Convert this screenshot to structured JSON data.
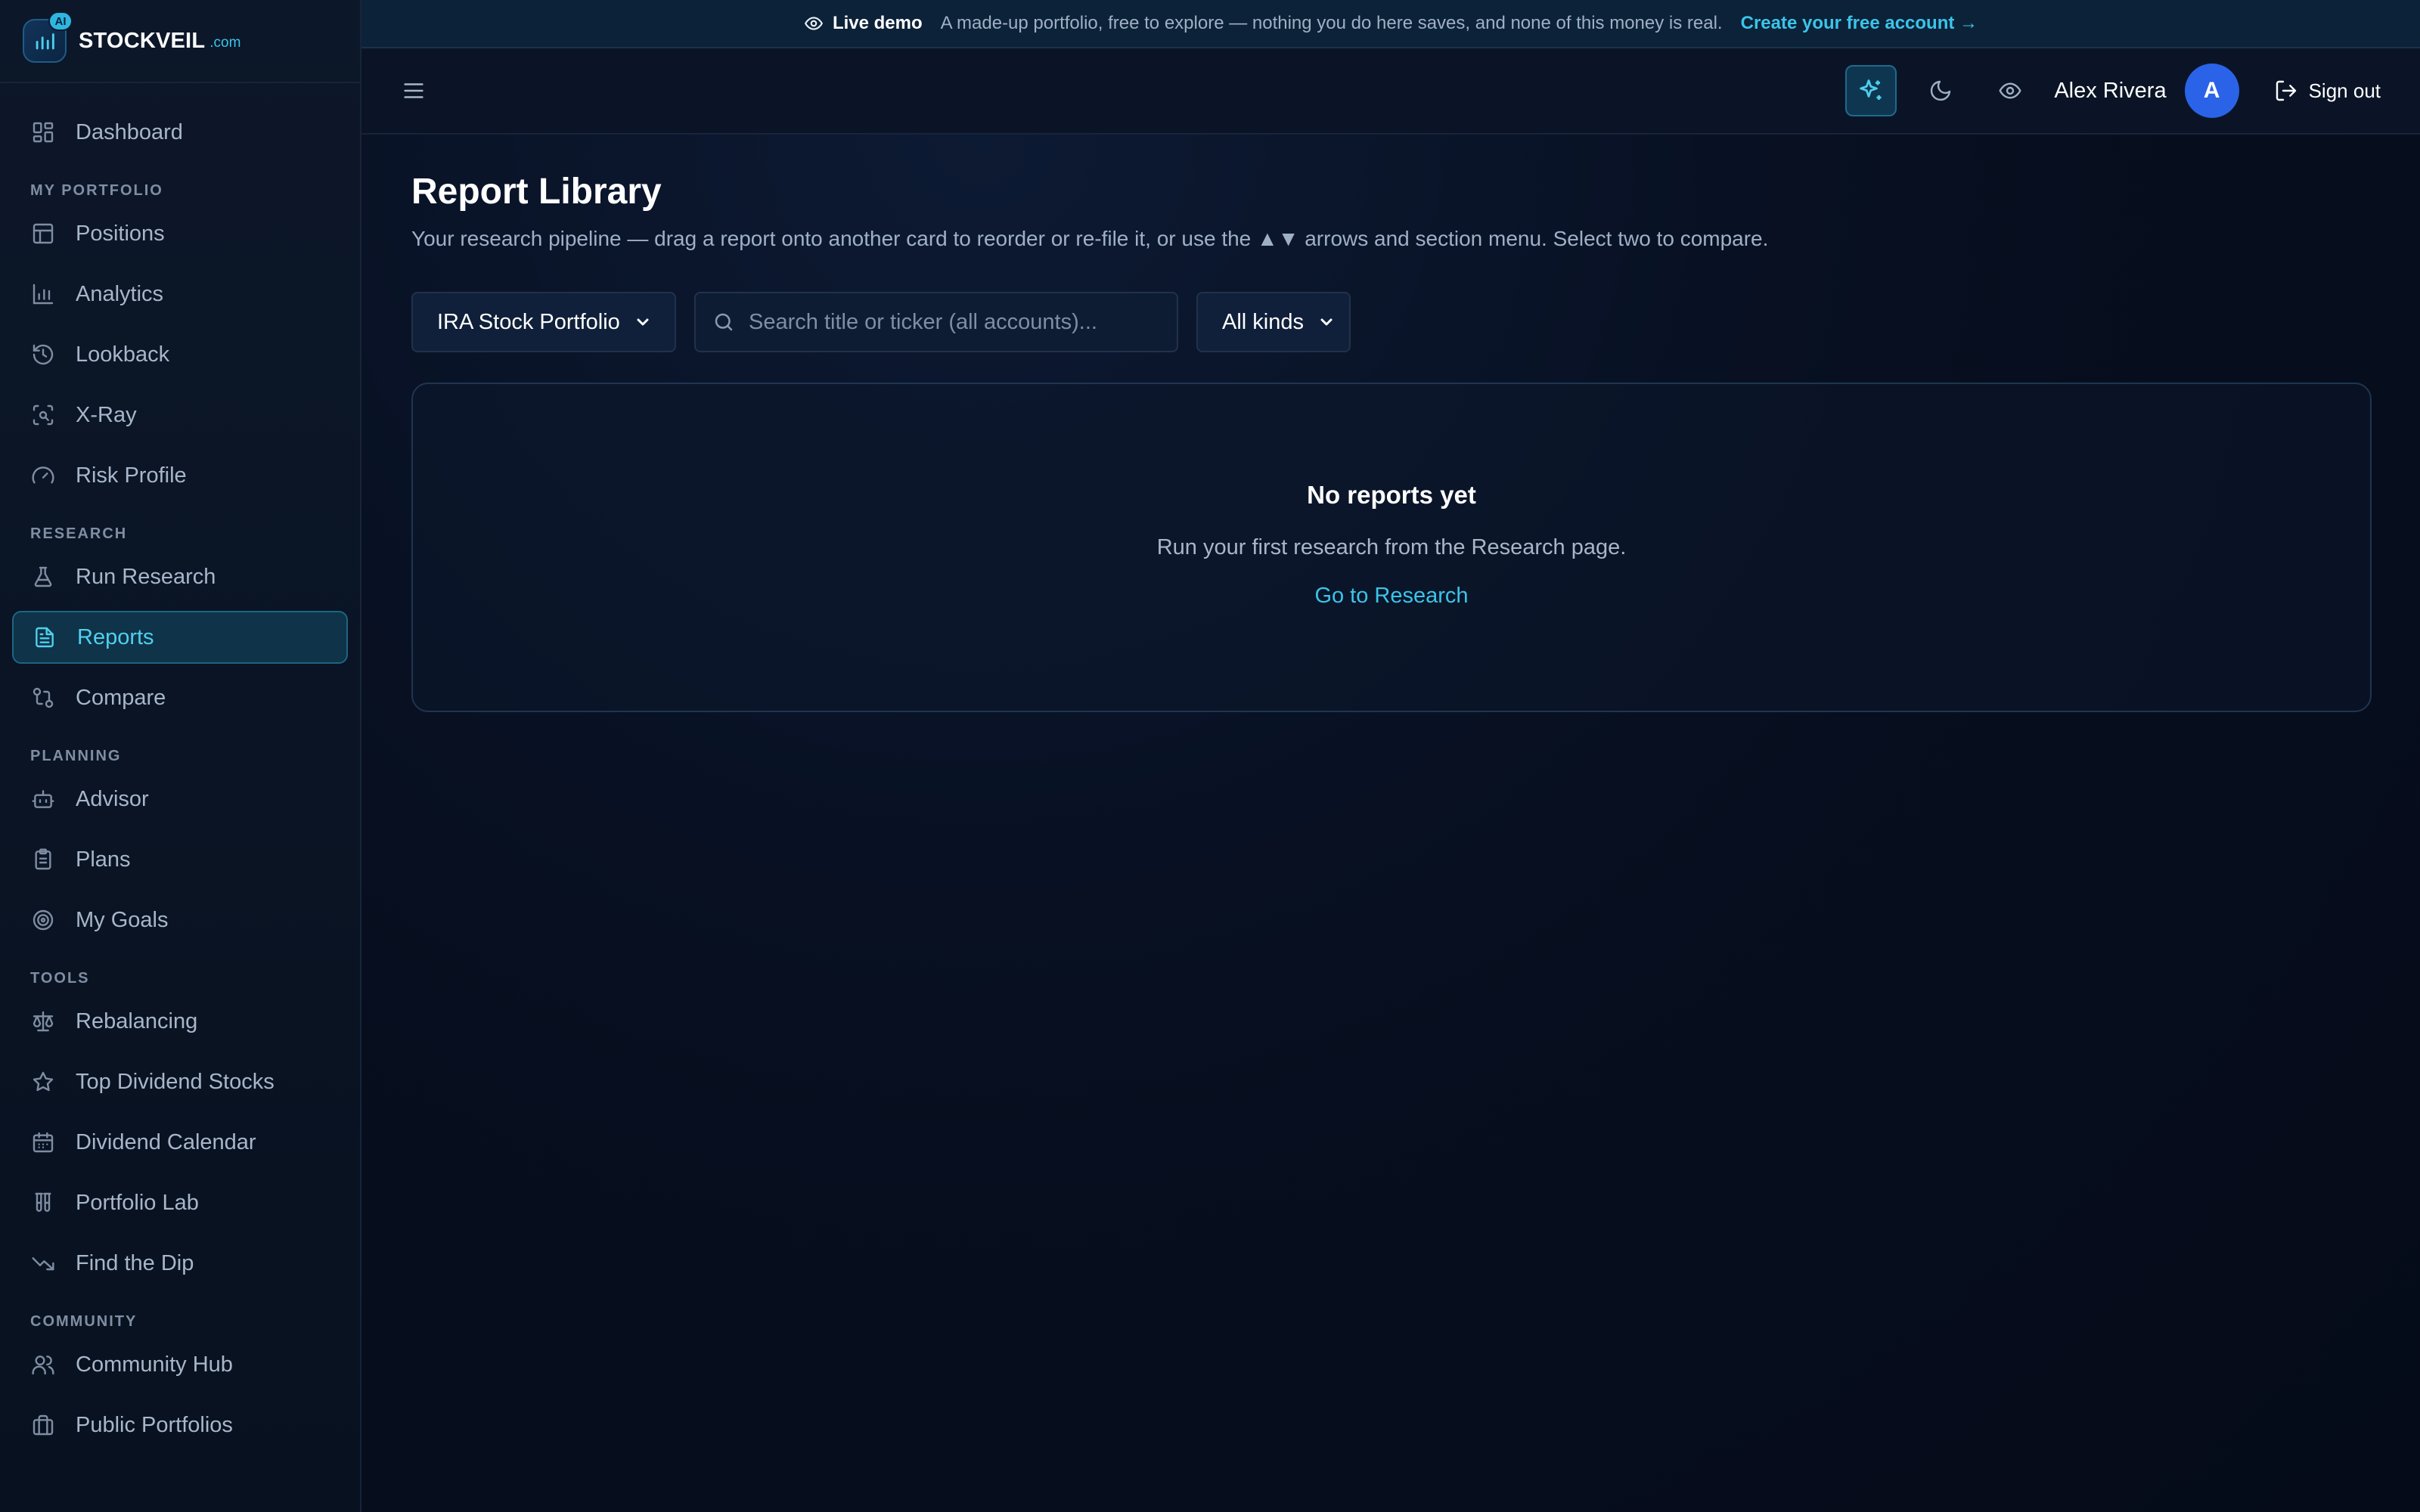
{
  "brand": {
    "name": "STOCKVEIL",
    "tld": ".com",
    "badge": "AI"
  },
  "banner": {
    "label": "Live demo",
    "text": "A made-up portfolio, free to explore — nothing you do here saves, and none of this money is real.",
    "link": "Create your free account →"
  },
  "header": {
    "user_name": "Alex Rivera",
    "avatar_initial": "A",
    "sign_out": "Sign out"
  },
  "sidebar": {
    "dashboard": "Dashboard",
    "sections": {
      "portfolio": "MY PORTFOLIO",
      "research": "RESEARCH",
      "planning": "PLANNING",
      "tools": "TOOLS",
      "community": "COMMUNITY"
    },
    "portfolio": [
      "Positions",
      "Analytics",
      "Lookback",
      "X-Ray",
      "Risk Profile"
    ],
    "research": [
      "Run Research",
      "Reports",
      "Compare"
    ],
    "planning": [
      "Advisor",
      "Plans",
      "My Goals"
    ],
    "tools": [
      "Rebalancing",
      "Top Dividend Stocks",
      "Dividend Calendar",
      "Portfolio Lab",
      "Find the Dip"
    ],
    "community": [
      "Community Hub",
      "Public Portfolios"
    ],
    "active": "Reports"
  },
  "page": {
    "title": "Report Library",
    "subtitle": "Your research pipeline — drag a report onto another card to reorder or re-file it, or use the ▲▼ arrows and section menu. Select two to compare."
  },
  "filters": {
    "portfolio_select": "IRA Stock Portfolio",
    "search_placeholder": "Search title or ticker (all accounts)...",
    "kind_select": "All kinds"
  },
  "empty": {
    "title": "No reports yet",
    "text": "Run your first research from the Research page.",
    "link": "Go to Research"
  },
  "colors": {
    "accent": "#3bc4ea",
    "avatar": "#2a63e8",
    "background": "#060d1c"
  }
}
